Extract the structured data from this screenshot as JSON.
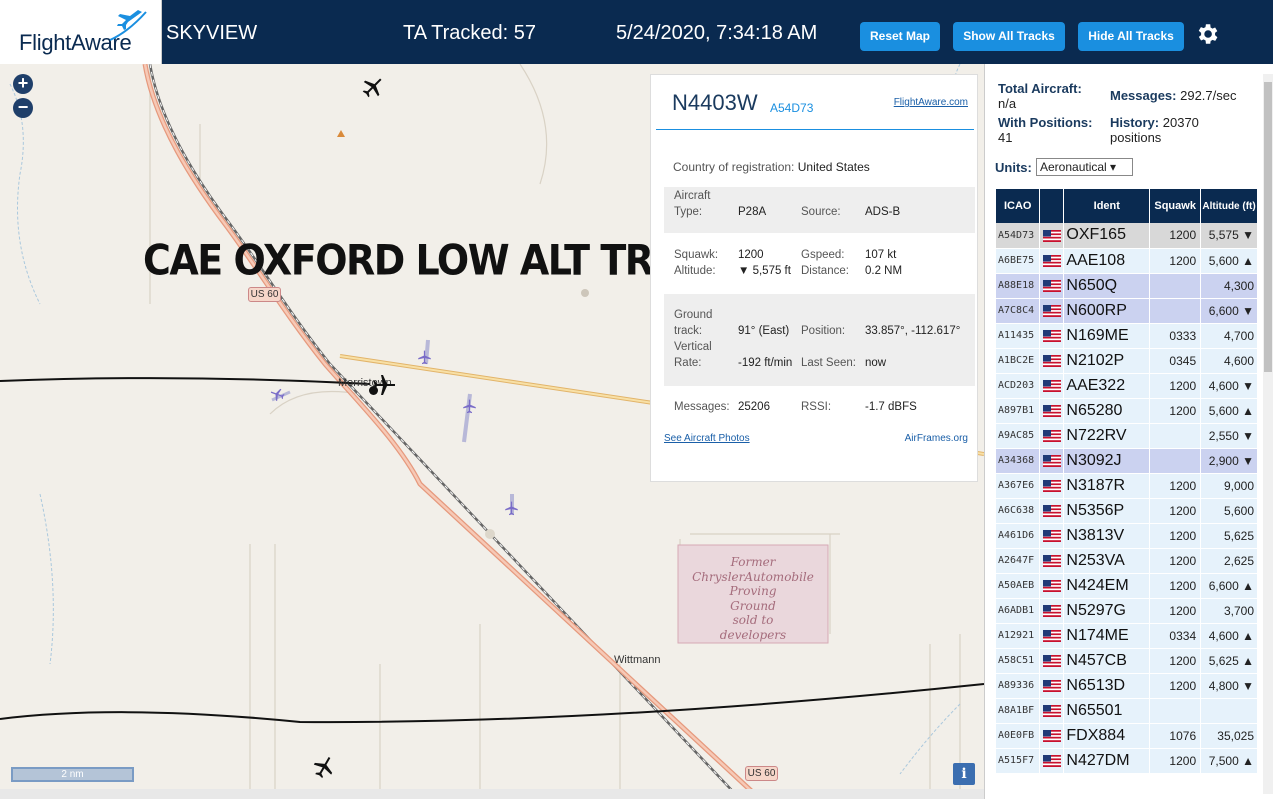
{
  "header": {
    "logo": "FlightAware",
    "title": "SKYVIEW",
    "tracked": "TA Tracked: 57",
    "datetime": "5/24/2020, 7:34:18 AM",
    "reset_label": "Reset Map",
    "show_label": "Show All Tracks",
    "hide_label": "Hide All Tracks",
    "settings_icon": "gear-icon"
  },
  "map": {
    "zoom_in": "+",
    "zoom_out": "−",
    "overlay_title": "CAE OXFORD LOW ALT TRASH",
    "us60_a": "US 60",
    "us60_b": "US 60",
    "town_morristown": "Morristown",
    "town_wittmann": "Wittmann",
    "former_line1": "Former",
    "former_line2": "ChryslerAutomobile",
    "former_line3": "Proving",
    "former_line4": "Ground",
    "former_line5": "sold to",
    "former_line6": "developers",
    "scale": "2 nm",
    "info": "i"
  },
  "popup": {
    "registration": "N4403W",
    "hex": "A54D73",
    "link": "FlightAware.com",
    "country_label": "Country of registration:",
    "country_value": "United States",
    "aircraft_type_label1": "Aircraft",
    "aircraft_type_label2": "Type:",
    "aircraft_type": "P28A",
    "source_label": "Source:",
    "source": "ADS-B",
    "squawk_label": "Squawk:",
    "squawk": "1200",
    "gspeed_label": "Gspeed:",
    "gspeed": "107 kt",
    "altitude_label": "Altitude:",
    "altitude": "▼ 5,575 ft",
    "distance_label": "Distance:",
    "distance": "0.2 NM",
    "track_label1": "Ground",
    "track_label2": "track:",
    "track": "91° (East)",
    "position_label": "Position:",
    "position": "33.857°, -112.617°",
    "vrate_label1": "Vertical",
    "vrate_label2": "Rate:",
    "vrate": "-192 ft/min",
    "lastseen_label": "Last Seen:",
    "lastseen": "now",
    "messages_label": "Messages:",
    "messages": "25206",
    "rssi_label": "RSSI:",
    "rssi": "-1.7 dBFS",
    "photos_link": "See Aircraft Photos",
    "airframes_link": "AirFrames.org"
  },
  "side": {
    "total_label": "Total Aircraft:",
    "total_value": "n/a",
    "messages_label": "Messages:",
    "messages_value": "292.7/sec",
    "withpos_label": "With Positions:",
    "withpos_value": "41",
    "history_label": "History:",
    "history_value": "20370",
    "history_unit": "positions",
    "units_label": "Units:",
    "units_value": "Aeronautical ▾",
    "columns": [
      "ICAO",
      "",
      "Ident",
      "Squawk",
      "Altitude (ft)"
    ],
    "rows": [
      {
        "icao": "A54D73",
        "ident": "OXF165",
        "squawk": "1200",
        "alt": "5,575 ▼",
        "state": "sel"
      },
      {
        "icao": "A6BE75",
        "ident": "AAE108",
        "squawk": "1200",
        "alt": "5,600 ▲",
        "state": ""
      },
      {
        "icao": "A88E18",
        "ident": "N650Q",
        "squawk": "",
        "alt": "4,300",
        "state": "hl"
      },
      {
        "icao": "A7C8C4",
        "ident": "N600RP",
        "squawk": "",
        "alt": "6,600 ▼",
        "state": "hl"
      },
      {
        "icao": "A11435",
        "ident": "N169ME",
        "squawk": "0333",
        "alt": "4,700",
        "state": ""
      },
      {
        "icao": "A1BC2E",
        "ident": "N2102P",
        "squawk": "0345",
        "alt": "4,600",
        "state": ""
      },
      {
        "icao": "ACD203",
        "ident": "AAE322",
        "squawk": "1200",
        "alt": "4,600 ▼",
        "state": ""
      },
      {
        "icao": "A897B1",
        "ident": "N65280",
        "squawk": "1200",
        "alt": "5,600 ▲",
        "state": ""
      },
      {
        "icao": "A9AC85",
        "ident": "N722RV",
        "squawk": "",
        "alt": "2,550 ▼",
        "state": ""
      },
      {
        "icao": "A34368",
        "ident": "N3092J",
        "squawk": "",
        "alt": "2,900 ▼",
        "state": "hl"
      },
      {
        "icao": "A367E6",
        "ident": "N3187R",
        "squawk": "1200",
        "alt": "9,000",
        "state": ""
      },
      {
        "icao": "A6C638",
        "ident": "N5356P",
        "squawk": "1200",
        "alt": "5,600",
        "state": ""
      },
      {
        "icao": "A461D6",
        "ident": "N3813V",
        "squawk": "1200",
        "alt": "5,625",
        "state": ""
      },
      {
        "icao": "A2647F",
        "ident": "N253VA",
        "squawk": "1200",
        "alt": "2,625",
        "state": ""
      },
      {
        "icao": "A50AEB",
        "ident": "N424EM",
        "squawk": "1200",
        "alt": "6,600 ▲",
        "state": ""
      },
      {
        "icao": "A6ADB1",
        "ident": "N5297G",
        "squawk": "1200",
        "alt": "3,700",
        "state": ""
      },
      {
        "icao": "A12921",
        "ident": "N174ME",
        "squawk": "0334",
        "alt": "4,600 ▲",
        "state": ""
      },
      {
        "icao": "A58C51",
        "ident": "N457CB",
        "squawk": "1200",
        "alt": "5,625 ▲",
        "state": ""
      },
      {
        "icao": "A89336",
        "ident": "N6513D",
        "squawk": "1200",
        "alt": "4,800 ▼",
        "state": ""
      },
      {
        "icao": "A8A1BF",
        "ident": "N65501",
        "squawk": "",
        "alt": "",
        "state": ""
      },
      {
        "icao": "A0E0FB",
        "ident": "FDX884",
        "squawk": "1076",
        "alt": "35,025",
        "state": ""
      },
      {
        "icao": "A515F7",
        "ident": "N427DM",
        "squawk": "1200",
        "alt": "7,500 ▲",
        "state": ""
      }
    ]
  },
  "colors": {
    "header_bg": "#0a2a50",
    "button_bg": "#1a8fe0",
    "row_bg": "#e6f2fb",
    "row_selected": "#d8d8d8",
    "row_highlight": "#cbd2f0"
  }
}
